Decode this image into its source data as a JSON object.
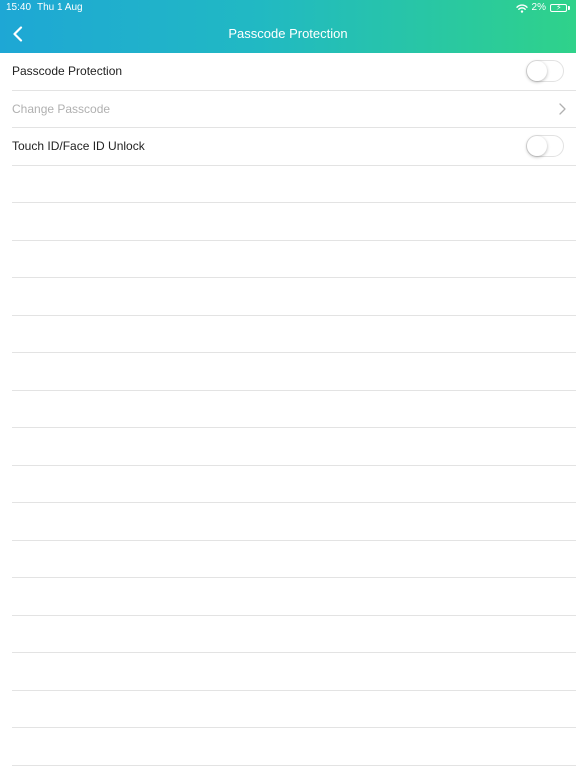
{
  "status_bar": {
    "time": "15:40",
    "date": "Thu 1 Aug",
    "battery": "2%",
    "icons": [
      "wifi-icon",
      "battery-charging-icon"
    ]
  },
  "nav": {
    "title": "Passcode Protection",
    "back_icon": "chevron-left-icon"
  },
  "colors": {
    "header_gradient_start": "#1ea7d5",
    "header_gradient_end": "#2fd28a",
    "disabled_text": "#b0b0b0",
    "separator": "#e3e3e3"
  },
  "settings": {
    "passcode_protection": {
      "label": "Passcode Protection",
      "enabled": false
    },
    "change_passcode": {
      "label": "Change Passcode",
      "disabled": true,
      "icon": "chevron-right-icon"
    },
    "touch_face_id": {
      "label": "Touch ID/Face ID Unlock",
      "enabled": false
    }
  }
}
